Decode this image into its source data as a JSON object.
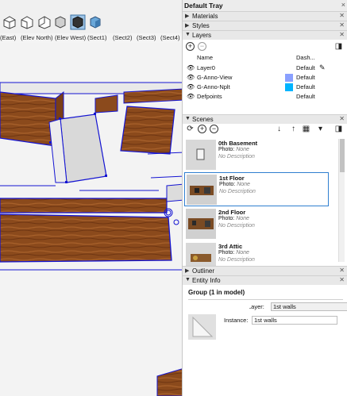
{
  "viewport": {
    "scene_tabs": [
      "(East)",
      "(Elev North)",
      "(Elev West)",
      "(Sect1)",
      "(Sect2)",
      "(Sect3)",
      "(Sect4)"
    ],
    "toolbar_icons": [
      "right-view-icon",
      "back-view-icon",
      "left-view-icon",
      "xray-style-icon",
      "wireframe-style-icon",
      "shaded-style-icon",
      "textured-style-icon"
    ]
  },
  "tray": {
    "title": "Default Tray",
    "close": "×",
    "panels": {
      "materials": "Materials",
      "styles": "Styles",
      "layers": "Layers",
      "scenes": "Scenes",
      "outliner": "Outliner",
      "entity_info": "Entity Info"
    },
    "layers": {
      "col_name": "Name",
      "col_dash": "Dash...",
      "rows": [
        {
          "name": "Layer0",
          "dash": "Default",
          "color": ""
        },
        {
          "name": "G-Anno-View",
          "dash": "Default",
          "color": "#8aa0ff"
        },
        {
          "name": "G-Anno-Nplt",
          "dash": "Default",
          "color": "#00b4ff"
        },
        {
          "name": "Defpoints",
          "dash": "Default",
          "color": ""
        }
      ]
    },
    "scenes": {
      "items": [
        {
          "name": "0th Basement",
          "photo_label": "Photo:",
          "photo_value": "None",
          "desc": "No Description"
        },
        {
          "name": "1st Floor",
          "photo_label": "Photo:",
          "photo_value": "None",
          "desc": "No Description"
        },
        {
          "name": "2nd Floor",
          "photo_label": "Photo:",
          "photo_value": "None",
          "desc": "No Description"
        },
        {
          "name": "3rd Attic",
          "photo_label": "Photo:",
          "photo_value": "None",
          "desc": "No Description"
        }
      ]
    },
    "entity": {
      "title": "Group (1 in model)",
      "layer_label": "Layer:",
      "layer_value": "1st walls",
      "instance_label": "Instance:",
      "instance_value": "1st walls"
    }
  },
  "colors": {
    "selection": "#1414d2",
    "wood": "#8b4a1c",
    "accent_blue": "#2f7fd0"
  }
}
